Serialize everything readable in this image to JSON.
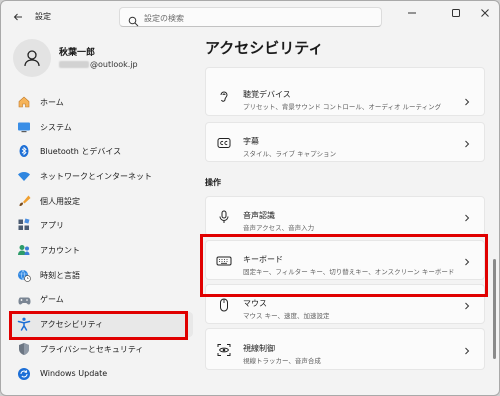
{
  "window": {
    "title": "設定"
  },
  "search": {
    "placeholder": "設定の検索"
  },
  "profile": {
    "name": "秋葉一郎",
    "email_suffix": "@outlook.jp"
  },
  "sidebar": {
    "items": [
      {
        "label": "ホーム",
        "icon": "home-icon"
      },
      {
        "label": "システム",
        "icon": "system-icon"
      },
      {
        "label": "Bluetooth とデバイス",
        "icon": "bluetooth-icon"
      },
      {
        "label": "ネットワークとインターネット",
        "icon": "wifi-icon"
      },
      {
        "label": "個人用設定",
        "icon": "brush-icon"
      },
      {
        "label": "アプリ",
        "icon": "apps-icon"
      },
      {
        "label": "アカウント",
        "icon": "account-icon"
      },
      {
        "label": "時刻と言語",
        "icon": "globe-clock-icon"
      },
      {
        "label": "ゲーム",
        "icon": "game-icon"
      },
      {
        "label": "アクセシビリティ",
        "icon": "accessibility-icon",
        "selected": true
      },
      {
        "label": "プライバシーとセキュリティ",
        "icon": "shield-icon"
      },
      {
        "label": "Windows Update",
        "icon": "update-icon"
      }
    ]
  },
  "main": {
    "title": "アクセシビリティ",
    "top_cards": [
      {
        "title": "聴覚デバイス",
        "subtitle": "プリセット、背景サウンド コントロール、オーディオ ルーティング",
        "icon": "hearing-icon"
      },
      {
        "title": "字幕",
        "subtitle": "スタイル、ライブ キャプション",
        "icon": "captions-icon"
      }
    ],
    "section_label": "操作",
    "interaction_cards": [
      {
        "title": "音声認識",
        "subtitle": "音声アクセス、音声入力",
        "icon": "microphone-icon"
      },
      {
        "title": "キーボード",
        "subtitle": "固定キー、フィルター キー、切り替えキー、オンスクリーン キーボード",
        "icon": "keyboard-icon"
      },
      {
        "title": "マウス",
        "subtitle": "マウス キー、速度、加速設定",
        "icon": "mouse-icon"
      },
      {
        "title": "視線制御",
        "subtitle": "視線トラッカー、音声合成",
        "icon": "eye-control-icon"
      }
    ]
  },
  "colors": {
    "accent": "#0067c0",
    "highlight": "#e00000"
  }
}
